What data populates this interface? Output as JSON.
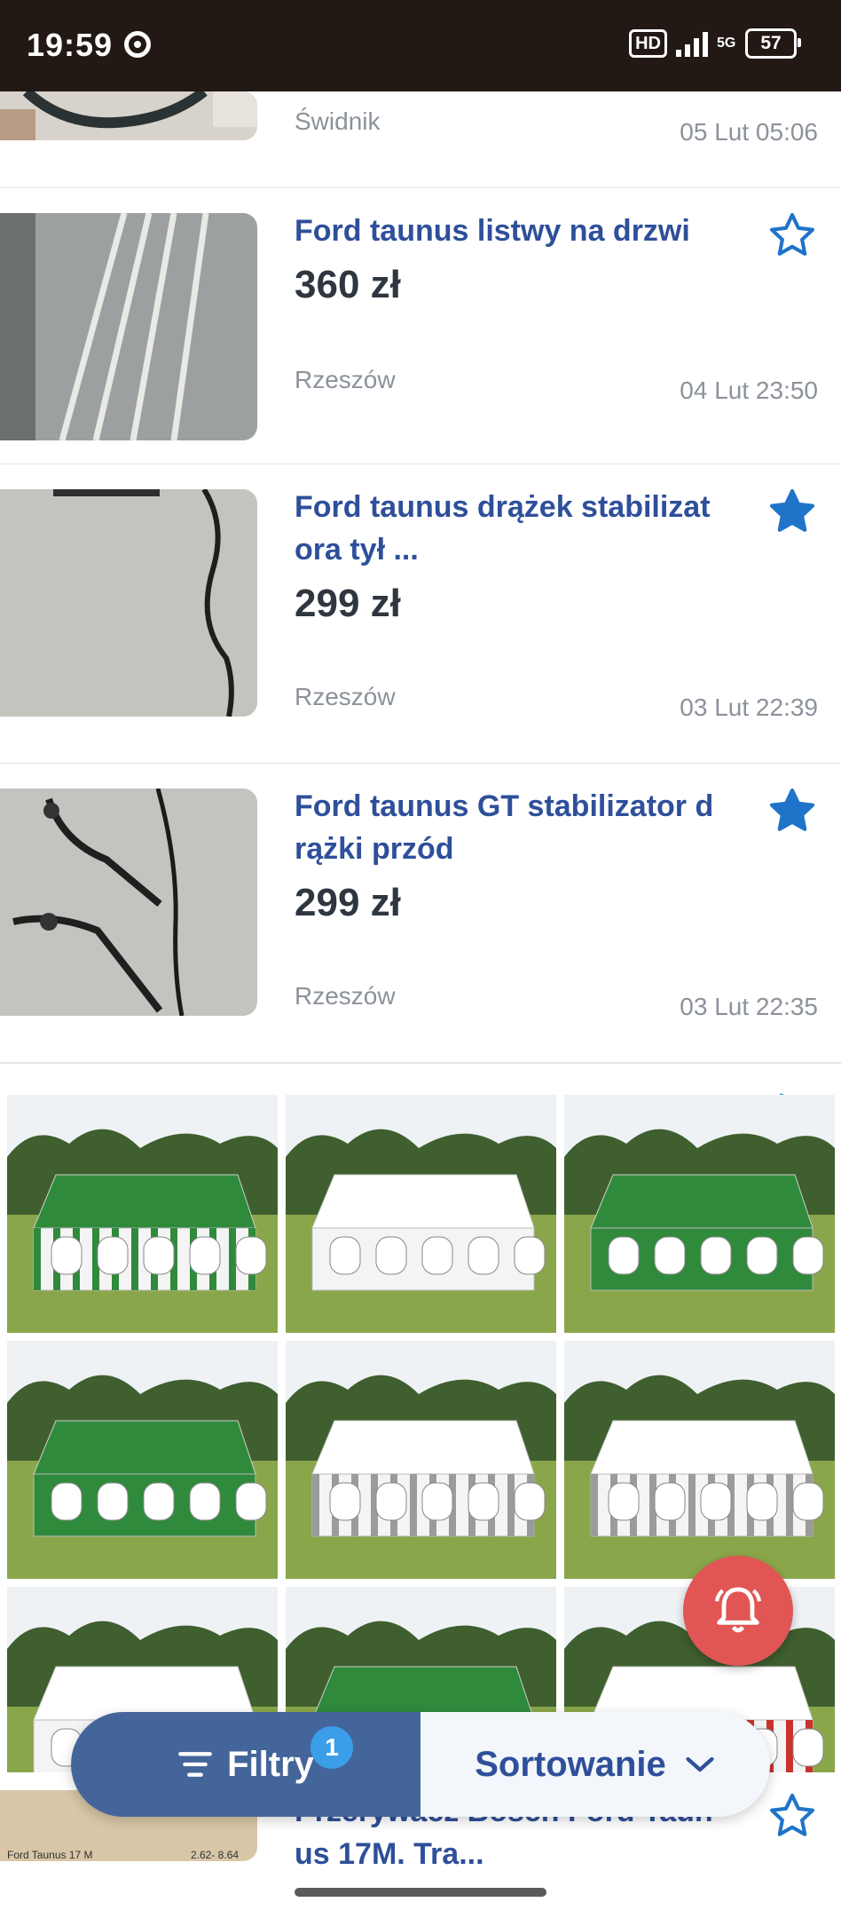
{
  "status_bar": {
    "time": "19:59",
    "hd": "HD",
    "network": "5G",
    "battery": "57"
  },
  "listings": [
    {
      "title": "",
      "price": "",
      "city": "Świdnik",
      "date": "05 Lut 05:06",
      "favorited": false
    },
    {
      "title": "Ford taunus listwy na drzwi",
      "price": "360 zł",
      "city": "Rzeszów",
      "date": "04 Lut 23:50",
      "favorited": false
    },
    {
      "title": "Ford taunus drążek stabilizat ora tył ...",
      "price": "299 zł",
      "city": "Rzeszów",
      "date": "03 Lut 22:39",
      "favorited": true
    },
    {
      "title": "Ford taunus GT stabilizator d rążki przód",
      "price": "299 zł",
      "city": "Rzeszów",
      "date": "03 Lut 22:35",
      "favorited": true
    },
    {
      "title": "Przerywacz Bosch Ford Taun us 17M. Tra...",
      "price": "",
      "city": "",
      "date": "",
      "favorited": false,
      "thumb_caption": "Ford Taunus 17 M",
      "thumb_code": "2.62- 8.64"
    }
  ],
  "ad": {
    "tents": [
      {
        "roof": "#2f8a3c",
        "walls": "striped-green"
      },
      {
        "roof": "#ffffff",
        "walls": "white"
      },
      {
        "roof": "#2f8a3c",
        "walls": "green"
      },
      {
        "roof": "#2f8a3c",
        "walls": "green"
      },
      {
        "roof": "#ffffff",
        "walls": "striped-grey"
      },
      {
        "roof": "#ffffff",
        "walls": "striped-grey"
      },
      {
        "roof": "#ffffff",
        "walls": "white"
      },
      {
        "roof": "#2f8a3c",
        "walls": "striped-green"
      },
      {
        "roof": "#ffffff",
        "walls": "striped-red"
      }
    ]
  },
  "bottom_bar": {
    "filters_label": "Filtry",
    "filters_count": "1",
    "sort_label": "Sortowanie"
  },
  "colors": {
    "accent": "#2e4f9a",
    "star": "#1f74c9",
    "filter_bg": "#44659a",
    "bell": "#e25555"
  }
}
